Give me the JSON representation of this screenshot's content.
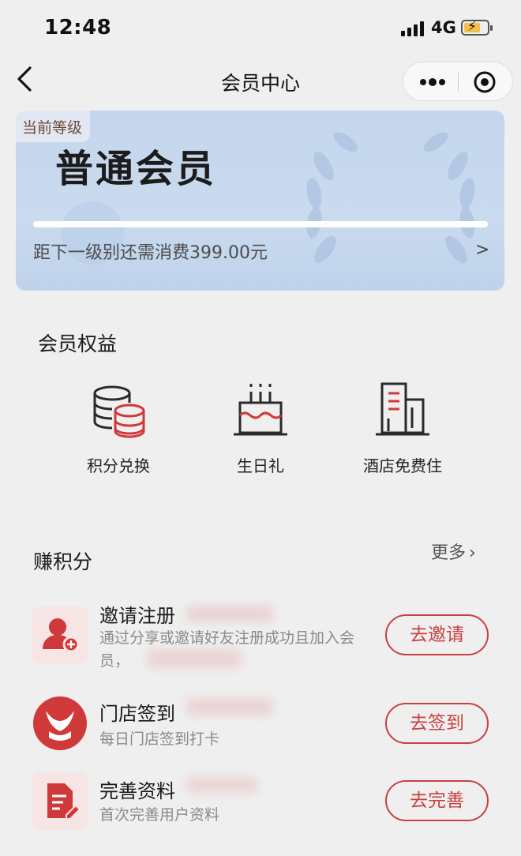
{
  "status_bar": {
    "time": "12:48",
    "network": "4G"
  },
  "nav": {
    "title": "会员中心"
  },
  "level_card": {
    "tag": "当前等级",
    "level_name": "普通会员",
    "hint": "距下一级别还需消费399.00元",
    "arrow": ">"
  },
  "benefits": {
    "title": "会员权益",
    "items": [
      {
        "label": "积分兑换",
        "icon": "coins-stack-icon"
      },
      {
        "label": "生日礼",
        "icon": "birthday-cake-icon"
      },
      {
        "label": "酒店免费住",
        "icon": "hotel-building-icon"
      }
    ]
  },
  "points": {
    "title": "赚积分",
    "more": "更多",
    "tasks": [
      {
        "title": "邀请注册",
        "desc": "通过分享或邀请好友注册成功且加入会员，",
        "button": "去邀请",
        "icon": "invite-user-icon"
      },
      {
        "title": "门店签到",
        "desc": "每日门店签到打卡",
        "button": "去签到",
        "icon": "store-checkin-logo-icon"
      },
      {
        "title": "完善资料",
        "desc": "首次完善用户资料",
        "button": "去完善",
        "icon": "edit-profile-icon"
      }
    ]
  },
  "colors": {
    "accent": "#c9403f",
    "card_bg": "#c7d8ee",
    "page_bg": "#efefef"
  }
}
